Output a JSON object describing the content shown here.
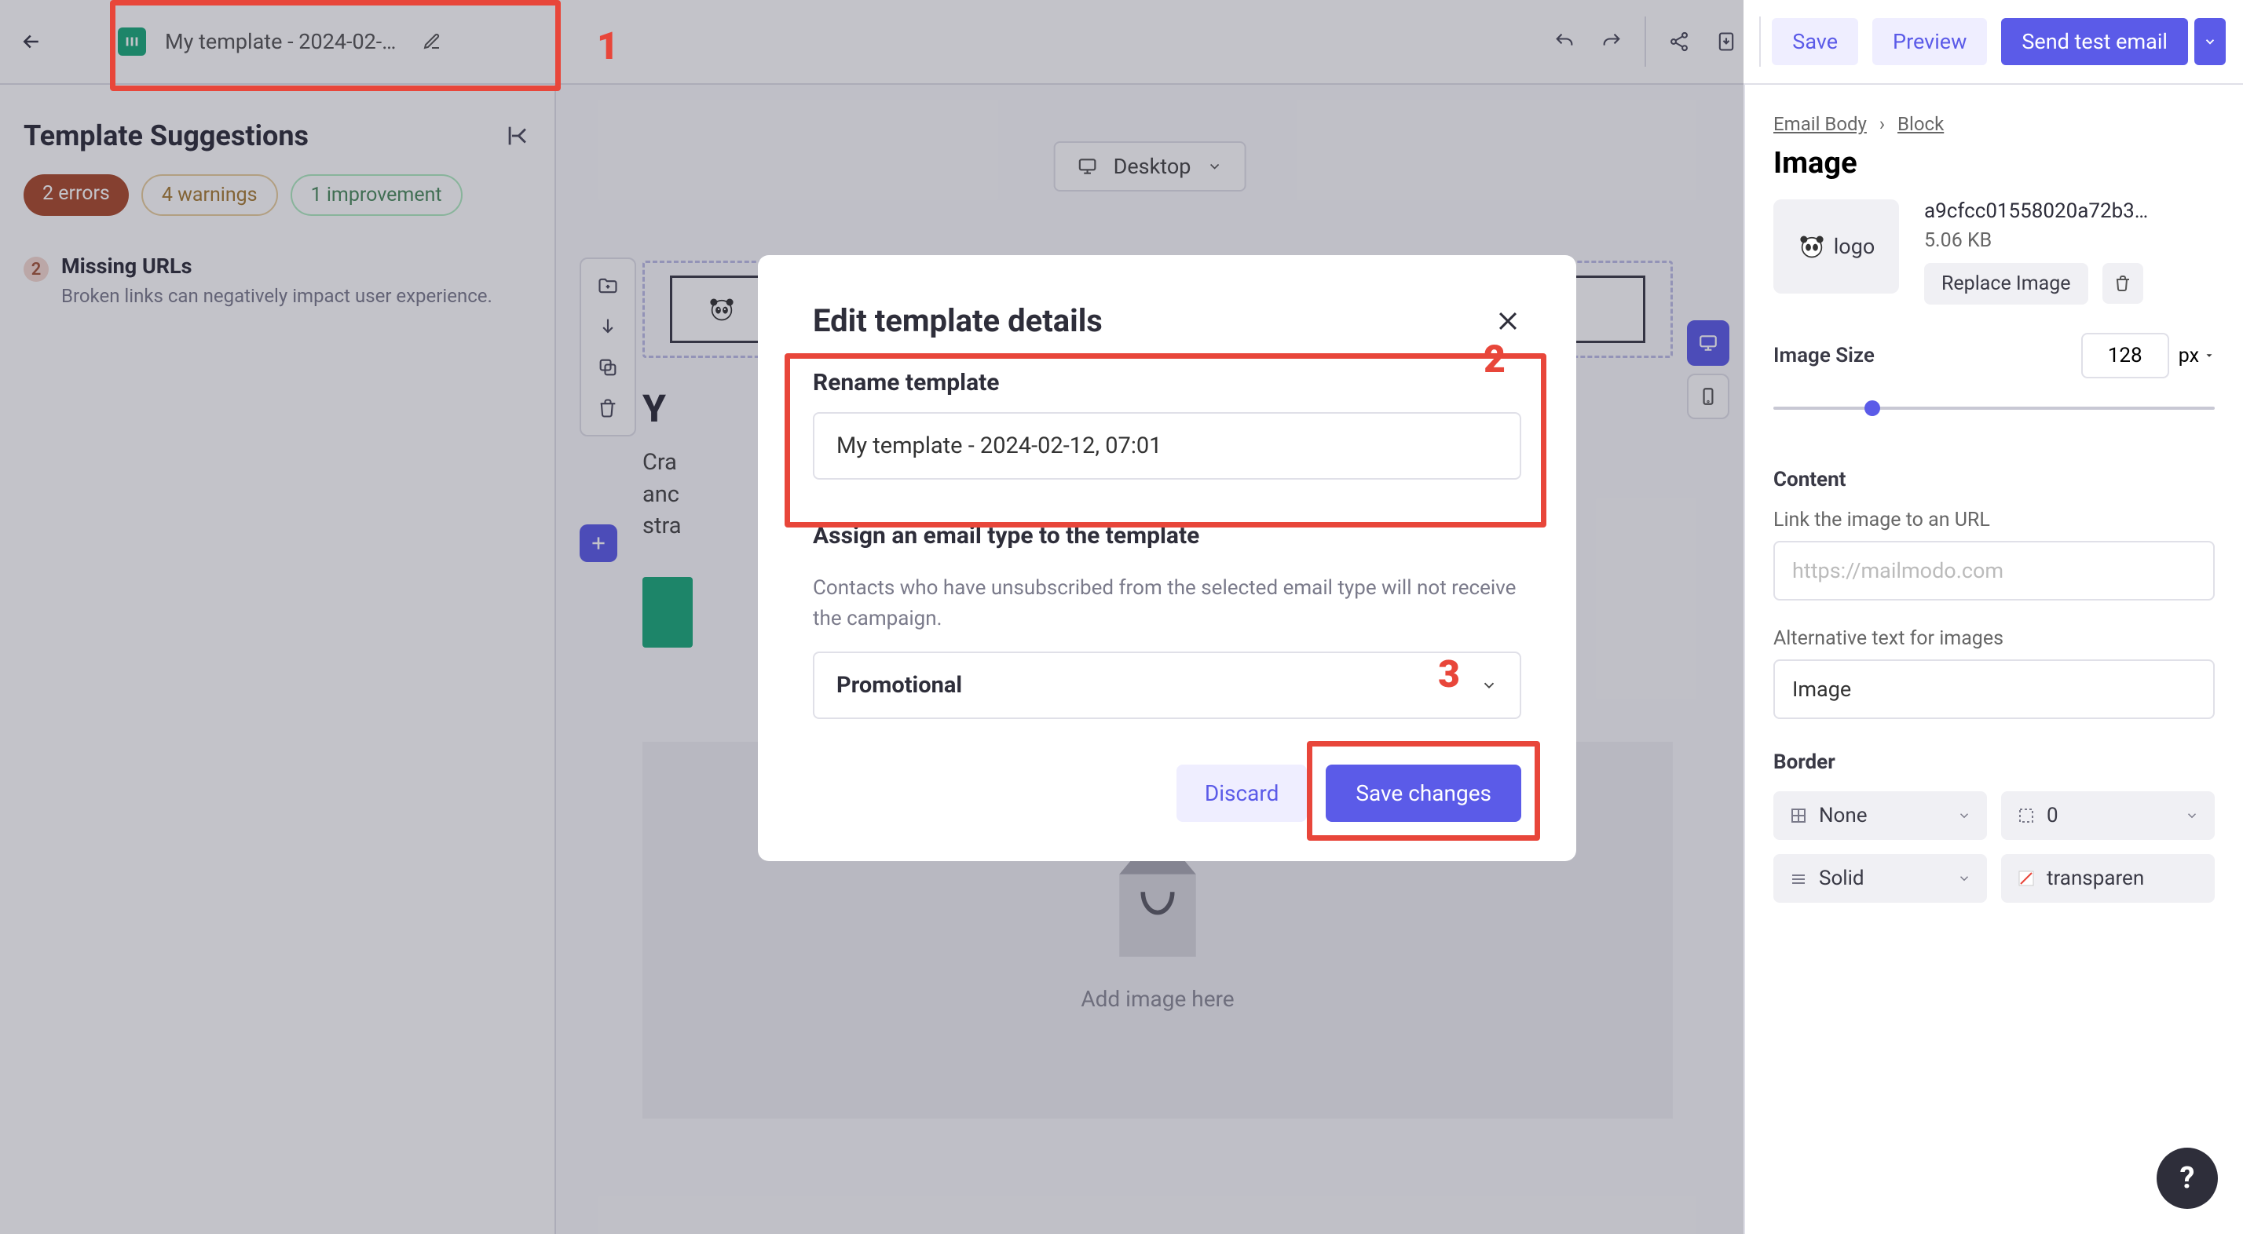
{
  "topbar": {
    "template_name_truncated": "My template - 2024-02-…",
    "save": "Save",
    "preview": "Preview",
    "send_test": "Send test email"
  },
  "leftbar": {
    "title": "Template Suggestions",
    "chip_errors": "2 errors",
    "chip_warnings": "4 warnings",
    "chip_improvement": "1 improvement",
    "sugg": {
      "count": "2",
      "title": "Missing URLs",
      "desc": "Broken links can negatively impact user experience."
    }
  },
  "canvas": {
    "view_mode": "Desktop",
    "hero_prefix": "Y",
    "para_line1": "Cra",
    "para_line2": "anc",
    "para_line3": "stra",
    "drop_label": "Add image here"
  },
  "rightbar": {
    "crumb1": "Email Body",
    "crumb2": "Block",
    "title": "Image",
    "thumb_label": "logo",
    "file_name": "a9cfcc01558020a72b3…",
    "file_size": "5.06 KB",
    "replace": "Replace Image",
    "size_label": "Image Size",
    "size_value": "128",
    "size_unit": "px",
    "content_label": "Content",
    "link_label": "Link the image to an URL",
    "link_placeholder": "https://mailmodo.com",
    "alt_label": "Alternative text for images",
    "alt_value": "Image",
    "border_label": "Border",
    "border_style1": "None",
    "border_width": "0",
    "border_style2": "Solid",
    "border_color": "transparen"
  },
  "modal": {
    "title": "Edit template details",
    "rename_label": "Rename template",
    "rename_value": "My template - 2024-02-12, 07:01",
    "type_label": "Assign an email type to the template",
    "type_desc": "Contacts who have unsubscribed from the selected email type will not receive the campaign.",
    "type_value": "Promotional",
    "discard": "Discard",
    "save": "Save changes"
  },
  "annotations": {
    "a1": "1",
    "a2": "2",
    "a3": "3"
  },
  "help": "?"
}
